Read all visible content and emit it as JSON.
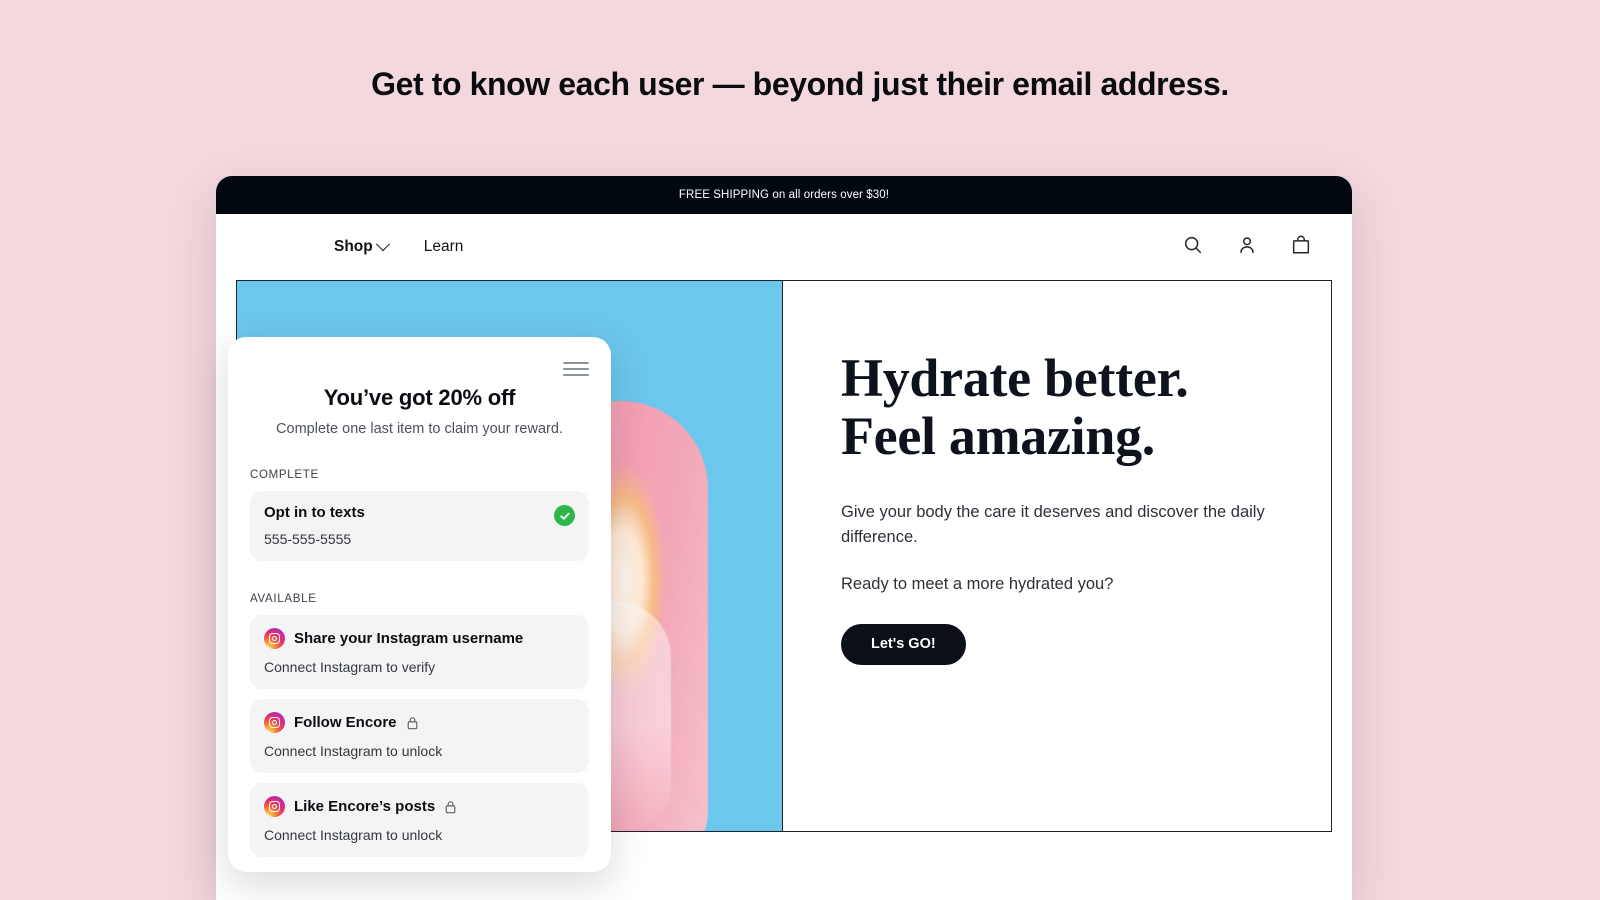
{
  "headline": "Get to know each user — beyond just their email address.",
  "browser": {
    "announcement": "FREE SHIPPING on all orders over $30!",
    "nav": {
      "links": [
        {
          "label": "Shop",
          "icon": "chevron-down-icon"
        },
        {
          "label": "Learn"
        }
      ],
      "icons": [
        "search-icon",
        "account-icon",
        "shopping-bag-icon"
      ]
    },
    "hero": {
      "title_line1": "Hydrate better.",
      "title_line2": "Feel amazing.",
      "body": "Give your body the care it deserves and discover the daily difference.",
      "question": "Ready to meet a more hydrated you?",
      "cta_label": "Let's GO!",
      "media_bg_color": "#6cc7ec",
      "product_color": "#f2a6b6"
    }
  },
  "reward_card": {
    "menu_icon": "hamburger-menu-icon",
    "title": "You’ve got 20% off",
    "subtitle": "Complete one last item to claim your reward.",
    "sections": [
      {
        "label": "COMPLETE",
        "tasks": [
          {
            "title": "Opt in to texts",
            "subtitle": "555-555-5555",
            "status": "complete",
            "status_icon": "green-check-icon",
            "status_color": "#2fb64a"
          }
        ]
      },
      {
        "label": "AVAILABLE",
        "tasks": [
          {
            "title": "Share your Instagram username",
            "subtitle": "Connect Instagram to verify",
            "icon": "instagram-icon",
            "locked": false
          },
          {
            "title": "Follow Encore",
            "subtitle": "Connect Instagram to unlock",
            "icon": "instagram-icon",
            "locked": true,
            "lock_icon": "lock-icon"
          },
          {
            "title": "Like Encore’s posts",
            "subtitle": "Connect Instagram to unlock",
            "icon": "instagram-icon",
            "locked": true,
            "lock_icon": "lock-icon"
          }
        ]
      }
    ]
  },
  "colors": {
    "page_background": "#f3d8de",
    "announcement_background": "#020810",
    "cta_background": "#0a0f18"
  }
}
